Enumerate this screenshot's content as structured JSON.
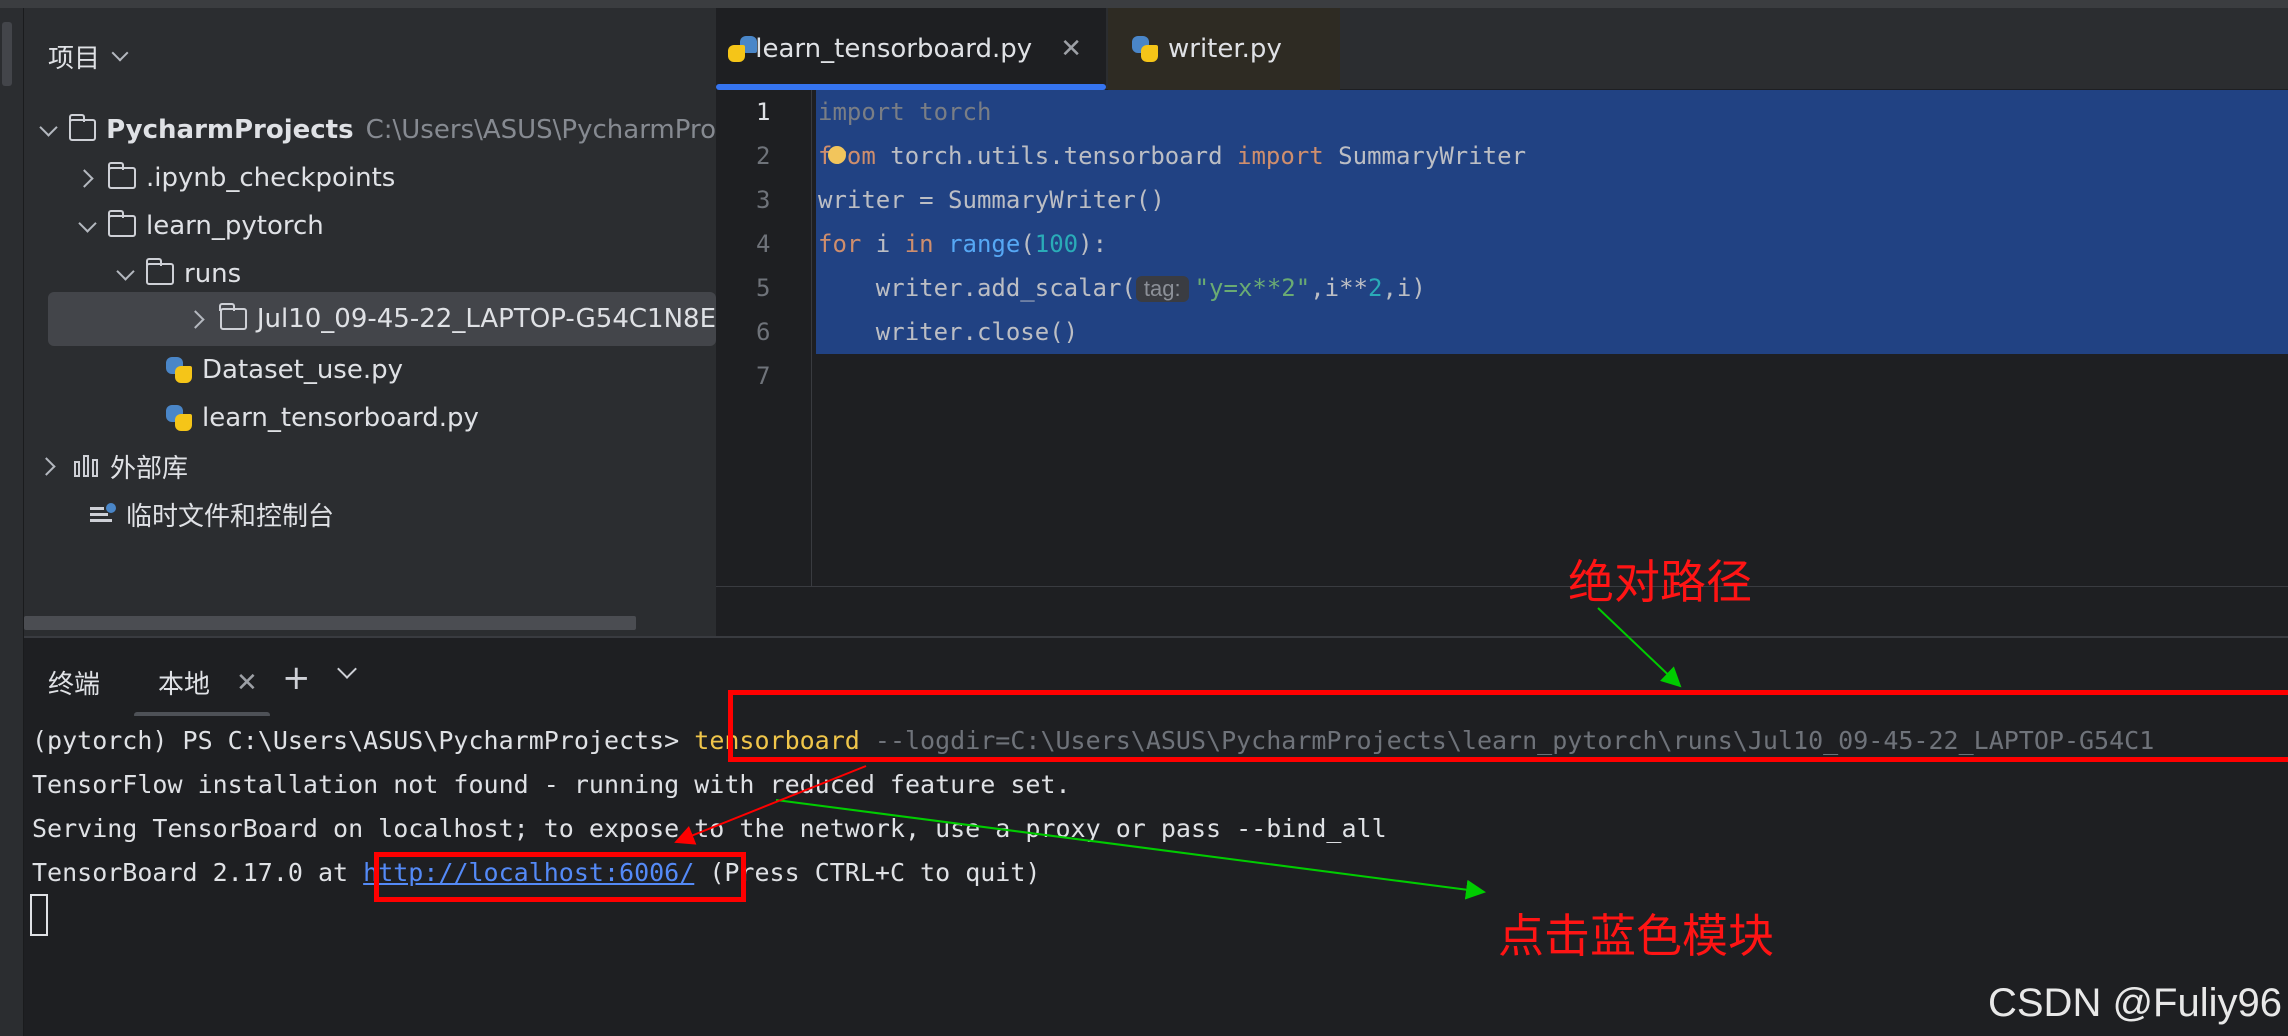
{
  "project_panel": {
    "title": "项目",
    "root": {
      "name": "PycharmProjects",
      "path": "C:\\Users\\ASUS\\PycharmPro"
    },
    "items": [
      {
        "label": ".ipynb_checkpoints"
      },
      {
        "label": "learn_pytorch"
      },
      {
        "label": "runs"
      },
      {
        "label": "Jul10_09-45-22_LAPTOP-G54C1N8E"
      },
      {
        "label": "Dataset_use.py"
      },
      {
        "label": "learn_tensorboard.py"
      },
      {
        "label": "外部库"
      },
      {
        "label": "临时文件和控制台"
      }
    ]
  },
  "editor": {
    "tabs": [
      {
        "label": "learn_tensorboard.py",
        "active": true
      },
      {
        "label": "writer.py",
        "active": false
      }
    ],
    "line_numbers": [
      "1",
      "2",
      "3",
      "4",
      "5",
      "6",
      "7"
    ],
    "code": {
      "l1": "import torch",
      "l2_a": "from",
      "l2_b": " torch.utils.tensorboard ",
      "l2_c": "import",
      "l2_d": " SummaryWriter",
      "l3": "writer = SummaryWriter()",
      "l4_a": "for",
      "l4_b": " i ",
      "l4_c": "in",
      "l4_d": " ",
      "l4_e": "range",
      "l4_f": "(",
      "l4_g": "100",
      "l4_h": "):",
      "l5_a": "    writer.add_scalar(",
      "l5_hint": "tag:",
      "l5_b": "\"y=x**2\"",
      "l5_c": ",i**",
      "l5_d": "2",
      "l5_e": ",i)",
      "l6": "    writer.close()"
    }
  },
  "terminal": {
    "title": "终端",
    "tab_label": "本地",
    "lines": {
      "prompt": "(pytorch) PS C:\\Users\\ASUS\\PycharmProjects> ",
      "cmd": "tensorboard",
      "args": " --logdir=C:\\Users\\ASUS\\PycharmProjects\\learn_pytorch\\runs\\Jul10_09-45-22_LAPTOP-G54C1",
      "l2": "TensorFlow installation not found - running with reduced feature set.",
      "l3": "Serving TensorBoard on localhost; to expose to the network, use a proxy or pass --bind_all",
      "l4_a": "TensorBoard 2.17.0 at ",
      "l4_link": "http://localhost:6006/",
      "l4_b": " (Press CTRL+C to quit)"
    }
  },
  "annotations": {
    "absolute_path": "绝对路径",
    "click_blue": "点击蓝色模块",
    "red": "#ff0000",
    "green": "#00cc00"
  },
  "watermark": "CSDN @Fuliy96"
}
